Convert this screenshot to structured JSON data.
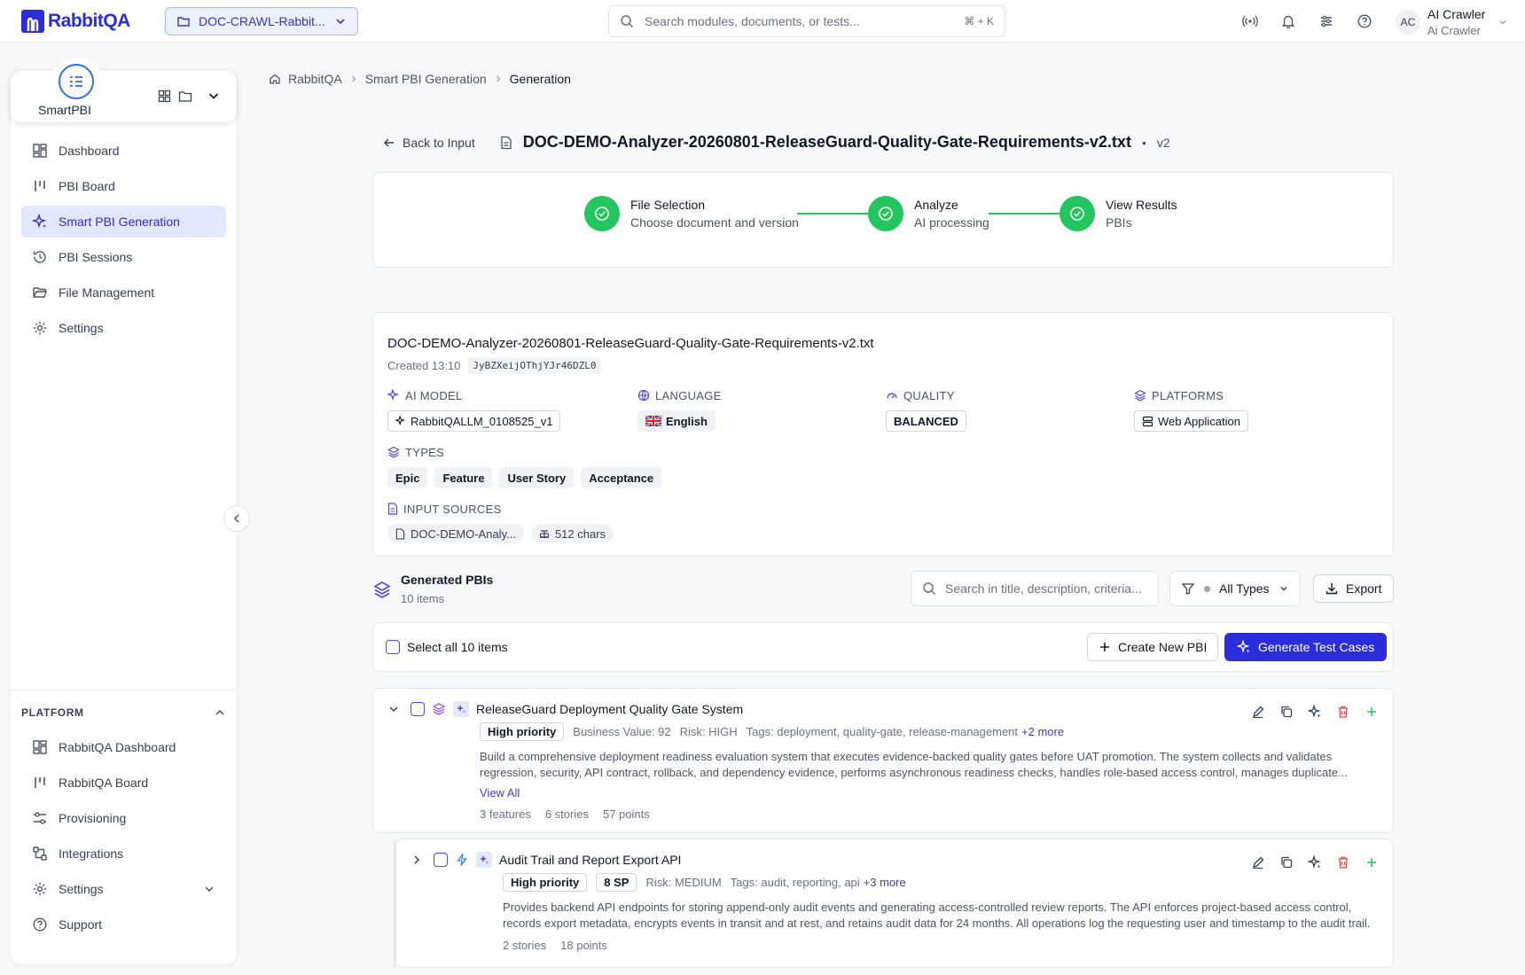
{
  "brand": {
    "name": "RabbitQA",
    "color": "#2b2ddb"
  },
  "project": {
    "label": "DOC-CRAWL-Rabbit..."
  },
  "search": {
    "placeholder": "Search modules, documents, or tests...",
    "shortcut": "⌘ + K"
  },
  "user": {
    "initials": "AC",
    "name": "AI Crawler",
    "sub": "Ai Crawler"
  },
  "sidebar": {
    "app_name": "SmartPBI",
    "items": [
      {
        "label": "Dashboard",
        "icon": "dashboard-icon"
      },
      {
        "label": "PBI Board",
        "icon": "board-icon"
      },
      {
        "label": "Smart PBI Generation",
        "icon": "sparkle-icon",
        "active": true
      },
      {
        "label": "PBI Sessions",
        "icon": "history-icon"
      },
      {
        "label": "File Management",
        "icon": "folder-icon"
      },
      {
        "label": "Settings",
        "icon": "gear-icon"
      }
    ],
    "platform": {
      "heading": "PLATFORM",
      "items": [
        {
          "label": "RabbitQA Dashboard",
          "icon": "dashboard-icon"
        },
        {
          "label": "RabbitQA Board",
          "icon": "board-icon"
        },
        {
          "label": "Provisioning",
          "icon": "sliders-icon"
        },
        {
          "label": "Integrations",
          "icon": "integrations-icon"
        },
        {
          "label": "Settings",
          "icon": "gear-icon"
        },
        {
          "label": "Support",
          "icon": "help-icon"
        }
      ]
    }
  },
  "breadcrumb": [
    "RabbitQA",
    "Smart PBI Generation",
    "Generation"
  ],
  "header": {
    "back_label": "Back to Input",
    "doc_title": "DOC-DEMO-Analyzer-20260801-ReleaseGuard-Quality-Gate-Requirements-v2.txt",
    "version": "v2"
  },
  "steps": [
    {
      "title": "File Selection",
      "sub": "Choose document and version"
    },
    {
      "title": "Analyze",
      "sub": "AI processing"
    },
    {
      "title": "View Results",
      "sub": "PBIs"
    }
  ],
  "info": {
    "title": "DOC-DEMO-Analyzer-20260801-ReleaseGuard-Quality-Gate-Requirements-v2.txt",
    "created": "Created 13:10",
    "code": "JyBZXeijOThjYJr46DZL0",
    "ai_model_label": "AI MODEL",
    "ai_model": "RabbitQALLM_0108525_v1",
    "language_label": "LANGUAGE",
    "language": "English",
    "quality_label": "QUALITY",
    "quality": "BALANCED",
    "platforms_label": "PLATFORMS",
    "platform": "Web Application",
    "types_label": "TYPES",
    "types": [
      "Epic",
      "Feature",
      "User Story",
      "Acceptance"
    ],
    "sources_label": "INPUT SOURCES",
    "source_file": "DOC-DEMO-Analy...",
    "source_chars": "512 chars"
  },
  "generated": {
    "title": "Generated PBIs",
    "count": "10 items",
    "search_placeholder": "Search in title, description, criteria...",
    "filter": "All Types",
    "export": "Export",
    "select_all": "Select all 10 items",
    "create": "Create New PBI",
    "generate": "Generate Test Cases"
  },
  "pbis": [
    {
      "title": "ReleaseGuard Deployment Quality Gate System",
      "priority": "High priority",
      "business_value": "Business Value: 92",
      "risk": "Risk: HIGH",
      "tags": "Tags: deployment, quality-gate, release-management",
      "more": "+2 more",
      "desc1": "Build a comprehensive deployment readiness evaluation system that executes evidence-backed quality gates before UAT promotion. The system collects and validates",
      "desc2": "regression, security, API contract, rollback, and dependency evidence, performs asynchronous readiness checks, handles role-based access control, manages duplicate...",
      "view_all": "View All",
      "stats": [
        "3 features",
        "6 stories",
        "57 points"
      ]
    },
    {
      "title": "Audit Trail and Report Export API",
      "priority": "High priority",
      "sp": "8 SP",
      "risk": "Risk: MEDIUM",
      "tags": "Tags: audit, reporting, api",
      "more": "+3 more",
      "desc1": "Provides backend API endpoints for storing append-only audit events and generating access-controlled review reports. The API enforces project-based access control,",
      "desc2": "records export metadata, encrypts events in transit and at rest, and retains audit data for 24 months. All operations log the requesting user and timestamp to the audit trail.",
      "stats": [
        "2 stories",
        "18 points"
      ]
    }
  ]
}
